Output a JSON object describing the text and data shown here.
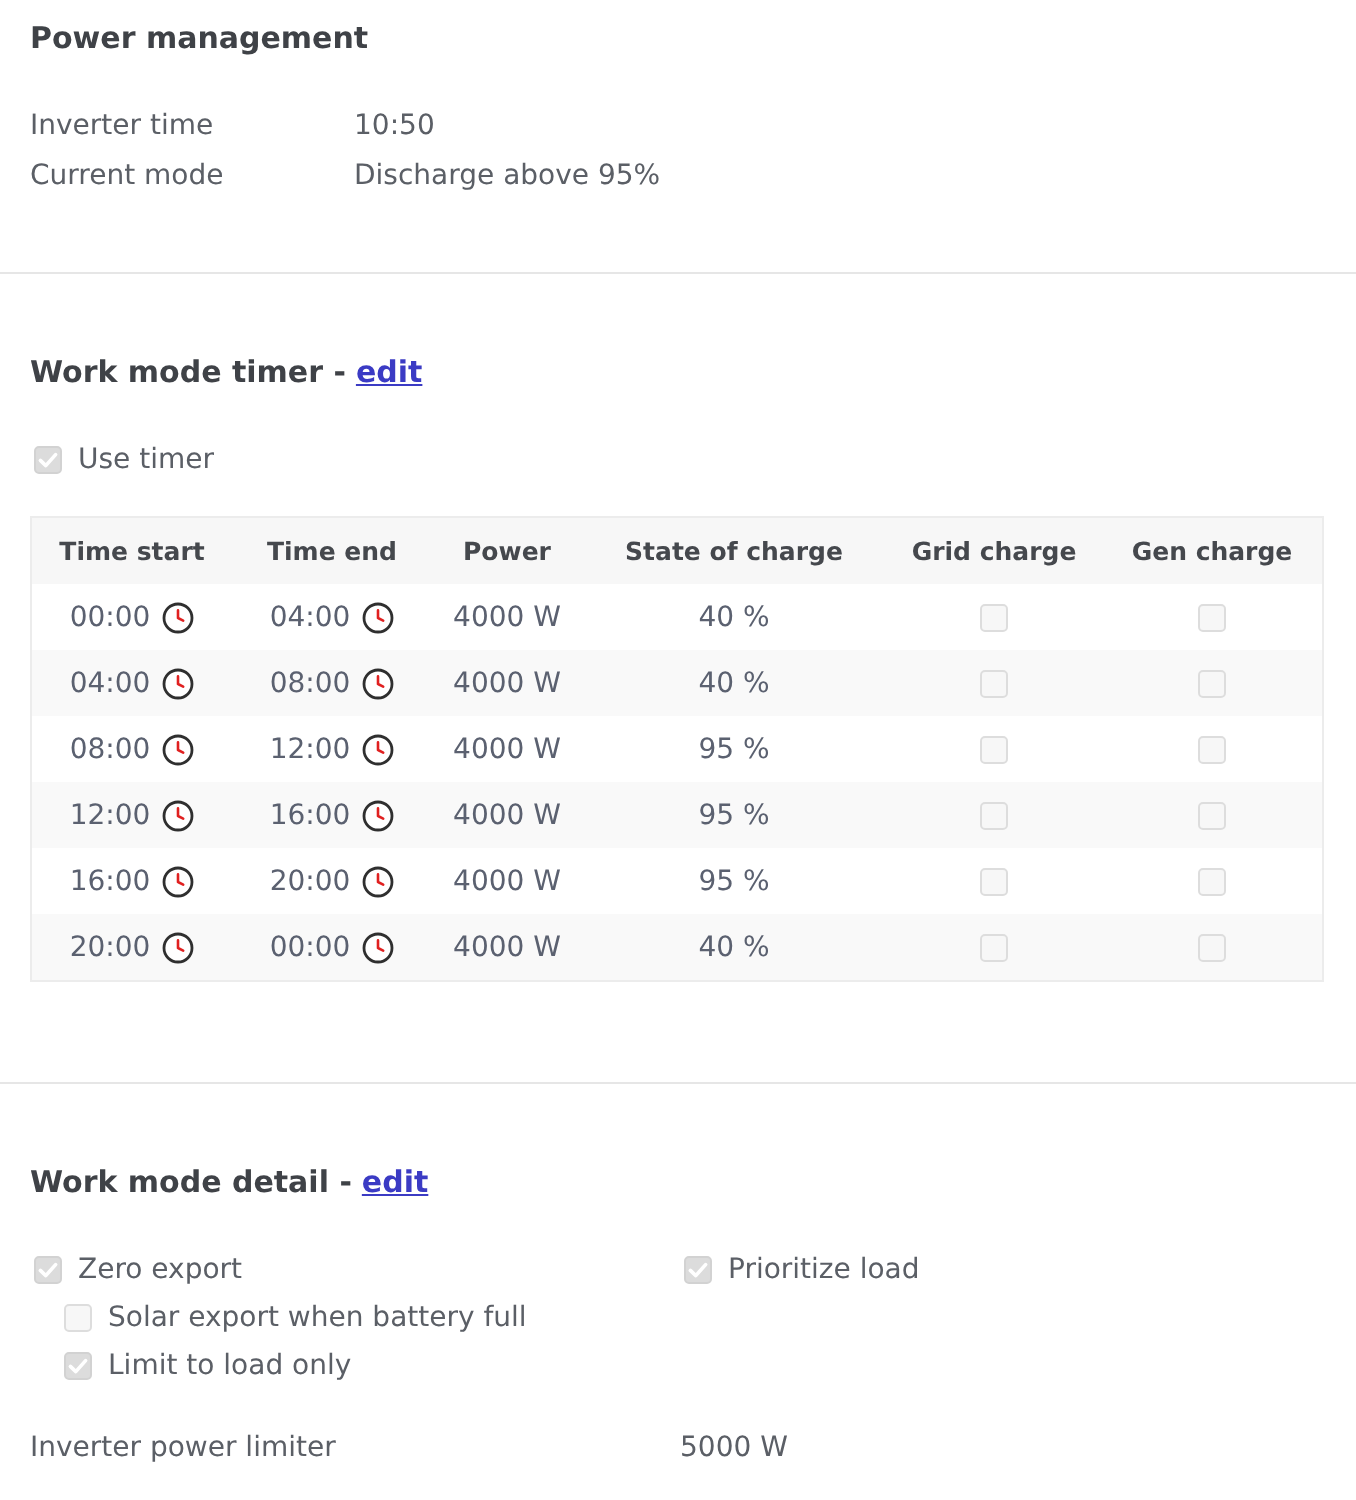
{
  "power_management": {
    "title": "Power management",
    "rows": [
      {
        "label": "Inverter time",
        "value": "10:50"
      },
      {
        "label": "Current mode",
        "value": "Discharge above 95%"
      }
    ]
  },
  "work_mode_timer": {
    "title": "Work mode timer -",
    "edit_link": "edit",
    "use_timer": {
      "label": "Use timer",
      "checked": true,
      "disabled": true
    },
    "table": {
      "disabled": true,
      "columns": [
        "Time start",
        "Time end",
        "Power",
        "State of charge",
        "Grid charge",
        "Gen charge"
      ],
      "rows": [
        {
          "time_start": "00:00",
          "time_end": "04:00",
          "power": "4000 W",
          "state_of_charge": "40 %",
          "grid_charge": {
            "checked": false
          },
          "gen_charge": {
            "checked": false
          }
        },
        {
          "time_start": "04:00",
          "time_end": "08:00",
          "power": "4000 W",
          "state_of_charge": "40 %",
          "grid_charge": {
            "checked": false
          },
          "gen_charge": {
            "checked": false
          }
        },
        {
          "time_start": "08:00",
          "time_end": "12:00",
          "power": "4000 W",
          "state_of_charge": "95 %",
          "grid_charge": {
            "checked": false
          },
          "gen_charge": {
            "checked": false
          }
        },
        {
          "time_start": "12:00",
          "time_end": "16:00",
          "power": "4000 W",
          "state_of_charge": "95 %",
          "grid_charge": {
            "checked": false
          },
          "gen_charge": {
            "checked": false
          }
        },
        {
          "time_start": "16:00",
          "time_end": "20:00",
          "power": "4000 W",
          "state_of_charge": "95 %",
          "grid_charge": {
            "checked": false
          },
          "gen_charge": {
            "checked": false
          }
        },
        {
          "time_start": "20:00",
          "time_end": "00:00",
          "power": "4000 W",
          "state_of_charge": "40 %",
          "grid_charge": {
            "checked": false
          },
          "gen_charge": {
            "checked": false
          }
        }
      ]
    }
  },
  "work_mode_detail": {
    "title": "Work mode detail -",
    "edit_link": "edit",
    "options": [
      {
        "label": "Zero export",
        "checked": true,
        "disabled": true,
        "children": [
          {
            "label": "Solar export when battery full",
            "checked": false,
            "disabled": true
          },
          {
            "label": "Limit to load only",
            "checked": true,
            "disabled": true
          }
        ]
      },
      {
        "label": "Prioritize load",
        "checked": true,
        "disabled": true
      }
    ],
    "rows": [
      {
        "label": "Inverter power limiter",
        "value": "5000 W"
      }
    ]
  }
}
